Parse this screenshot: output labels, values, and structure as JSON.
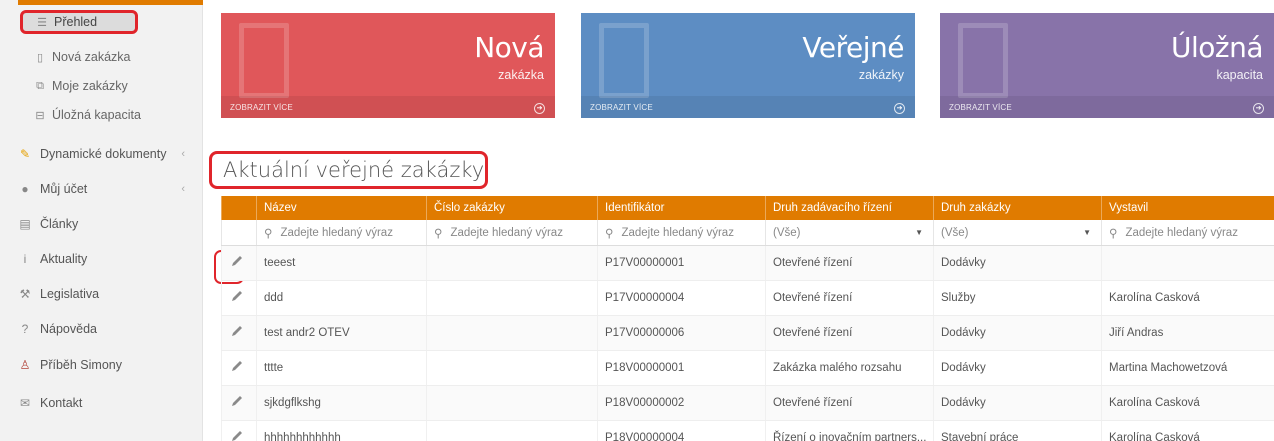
{
  "sidebar": {
    "subitems": [
      {
        "label": "Přehled",
        "icon": "list-icon"
      },
      {
        "label": "Nová zakázka",
        "icon": "file-icon"
      },
      {
        "label": "Moje zakázky",
        "icon": "files-icon"
      },
      {
        "label": "Úložná kapacita",
        "icon": "storage-icon"
      }
    ],
    "items": [
      {
        "label": "Dynamické dokumenty",
        "icon": "edit-icon",
        "chevron": "‹"
      },
      {
        "label": "Můj účet",
        "icon": "user-icon",
        "chevron": "‹"
      },
      {
        "label": "Články",
        "icon": "newspaper-icon"
      },
      {
        "label": "Aktuality",
        "icon": "info-icon"
      },
      {
        "label": "Legislativa",
        "icon": "gavel-icon"
      },
      {
        "label": "Nápověda",
        "icon": "help-icon"
      },
      {
        "label": "Příběh Simony",
        "icon": "person-icon"
      },
      {
        "label": "Kontakt",
        "icon": "mail-icon"
      }
    ]
  },
  "tiles": [
    {
      "title": "Nová",
      "subtitle": "zakázka",
      "more": "ZOBRAZIT VÍCE",
      "color": "#e0575a"
    },
    {
      "title": "Veřejné",
      "subtitle": "zakázky",
      "more": "ZOBRAZIT VÍCE",
      "color": "#5d8dc3"
    },
    {
      "title": "Úložná",
      "subtitle": "kapacita",
      "more": "ZOBRAZIT VÍCE",
      "color": "#8873a9"
    }
  ],
  "main": {
    "heading": "Aktuální veřejné zakázky"
  },
  "table": {
    "columns": [
      "Název",
      "Číslo zakázky",
      "Identifikátor",
      "Druh zadávacího řízení",
      "Druh zakázky",
      "Vystavil"
    ],
    "search_placeholder": "Zadejte hledaný výraz",
    "select_all": "(Vše)",
    "rows": [
      {
        "name": "teeest",
        "number": "",
        "id": "P17V00000001",
        "procedure": "Otevřené řízení",
        "type": "Dodávky",
        "issuer": ""
      },
      {
        "name": "ddd",
        "number": "",
        "id": "P17V00000004",
        "procedure": "Otevřené řízení",
        "type": "Služby",
        "issuer": "Karolína Casková"
      },
      {
        "name": "test andr2 OTEV",
        "number": "",
        "id": "P17V00000006",
        "procedure": "Otevřené řízení",
        "type": "Dodávky",
        "issuer": "Jiří Andras"
      },
      {
        "name": "tttte",
        "number": "",
        "id": "P18V00000001",
        "procedure": "Zakázka malého rozsahu",
        "type": "Dodávky",
        "issuer": "Martina Machowetzová"
      },
      {
        "name": "sjkdgflkshg",
        "number": "",
        "id": "P18V00000002",
        "procedure": "Otevřené řízení",
        "type": "Dodávky",
        "issuer": "Karolína Casková"
      },
      {
        "name": "hhhhhhhhhhhh",
        "number": "",
        "id": "P18V00000004",
        "procedure": "Řízení o inovačním partners...",
        "type": "Stavební práce",
        "issuer": "Karolína Casková"
      }
    ]
  }
}
